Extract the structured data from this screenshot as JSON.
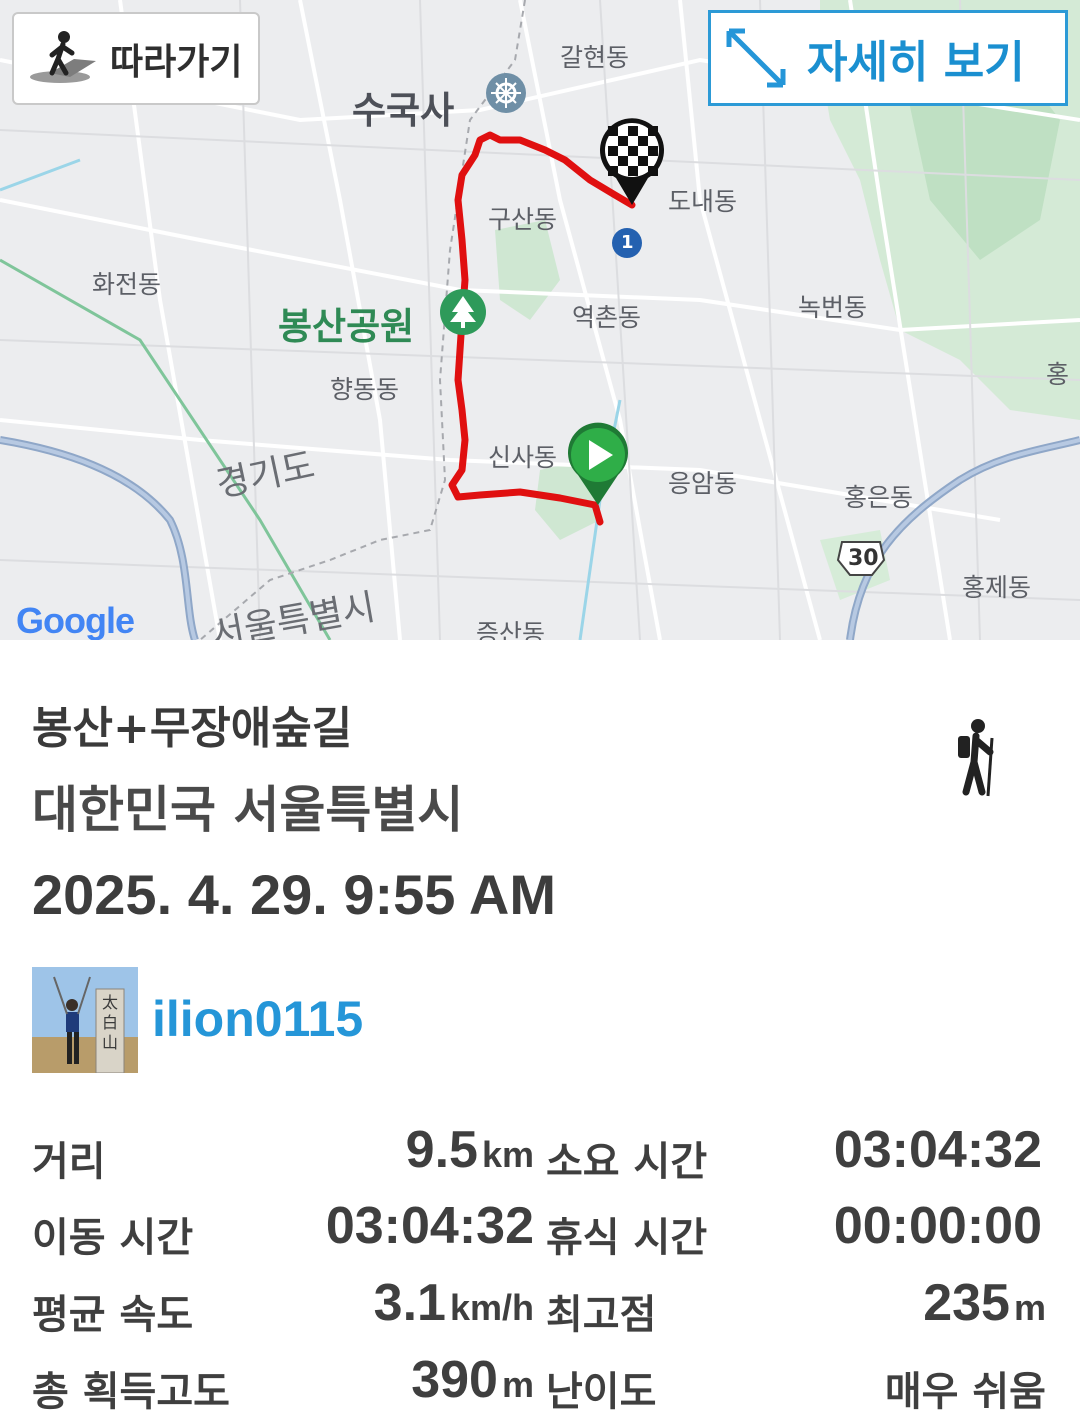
{
  "map": {
    "labels": {
      "galhyeon": "갈현동",
      "sugugsa": "수국사",
      "donae": "도내동",
      "gusan": "구산동",
      "hwajeon": "화전동",
      "bongsan_park": "봉산공원",
      "yeokchon": "역촌동",
      "nokbeon": "녹번동",
      "hangdong": "향동동",
      "gyeonggi": "경기도",
      "sinsa": "신사동",
      "eungam": "응암동",
      "hongeun": "홍은동",
      "hongje": "홍제동",
      "seoul": "서울특별시",
      "jeungsan": "증산동",
      "hong_partial": "홍"
    },
    "road_number": "30",
    "metro_number": "1",
    "google_logo": "Google",
    "follow_button": "따라가기",
    "detail_button": "자세히 보기",
    "colors": {
      "route": "#e01010",
      "start_marker": "#2fae48",
      "accent": "#2596d8"
    }
  },
  "track": {
    "title": "봉산+무장애숲길",
    "location": "대한민국 서울특별시",
    "datetime": "2025. 4. 29. 9:55 AM",
    "activity_icon": "hiking-icon",
    "user": {
      "name": "ilion0115",
      "avatar_caption": "太白山"
    }
  },
  "stats": {
    "distance": {
      "label": "거리",
      "value": "9.5",
      "unit": "km"
    },
    "total_time": {
      "label": "소요 시간",
      "value": "03:04:32"
    },
    "moving_time": {
      "label": "이동 시간",
      "value": "03:04:32"
    },
    "rest_time": {
      "label": "휴식 시간",
      "value": "00:00:00"
    },
    "avg_speed": {
      "label": "평균 속도",
      "value": "3.1",
      "unit": "km/h"
    },
    "max_altitude": {
      "label": "최고점",
      "value": "235",
      "unit": "m"
    },
    "total_ascent": {
      "label": "총 획득고도",
      "value": "390",
      "unit": "m"
    },
    "difficulty": {
      "label": "난이도",
      "value": "매우 쉬움"
    }
  }
}
